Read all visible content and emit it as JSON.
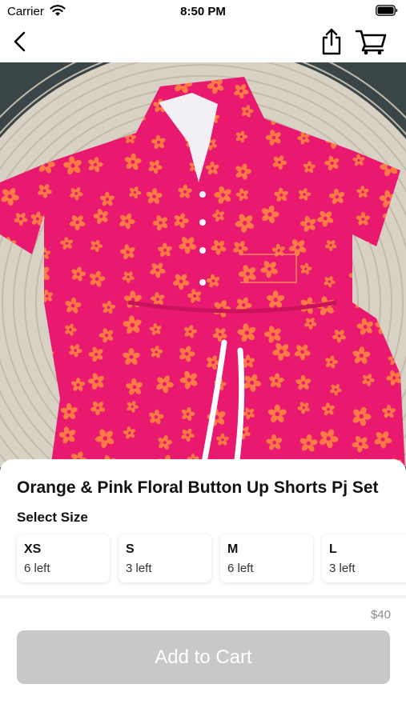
{
  "status_bar": {
    "carrier": "Carrier",
    "time": "8:50 PM"
  },
  "nav": {
    "back_icon": "chevron-left",
    "share_icon": "share",
    "cart_icon": "shopping-cart"
  },
  "product": {
    "title": "Orange & Pink Floral Button Up Shorts Pj Set",
    "image_colors": {
      "fabric": "#e8196e",
      "flower": "#ff7a45",
      "rug": "#d8d2c4"
    }
  },
  "size_section": {
    "heading": "Select Size",
    "sizes": [
      {
        "name": "XS",
        "stock": "6 left"
      },
      {
        "name": "S",
        "stock": "3 left"
      },
      {
        "name": "M",
        "stock": "6 left"
      },
      {
        "name": "L",
        "stock": "3 left"
      }
    ]
  },
  "price": "$40",
  "add_to_cart_label": "Add to Cart"
}
